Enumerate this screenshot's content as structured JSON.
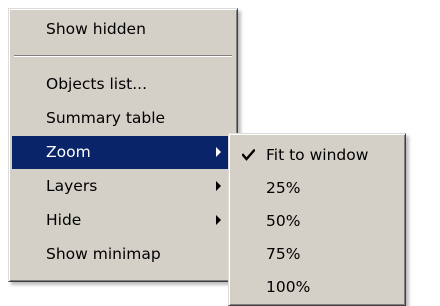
{
  "context_menu": {
    "items": [
      {
        "label": "Show hidden"
      },
      {
        "label": "Objects list..."
      },
      {
        "label": "Summary table"
      },
      {
        "label": "Zoom",
        "submenu": true,
        "highlighted": true
      },
      {
        "label": "Layers",
        "submenu": true
      },
      {
        "label": "Hide",
        "submenu": true
      },
      {
        "label": "Show minimap"
      }
    ]
  },
  "zoom_submenu": {
    "items": [
      {
        "label": "Fit to window",
        "checked": true,
        "icon": "checkmark-icon"
      },
      {
        "label": "25%"
      },
      {
        "label": "50%"
      },
      {
        "label": "75%"
      },
      {
        "label": "100%"
      }
    ]
  },
  "colors": {
    "menu_background": "#d4d0c8",
    "highlight": "#0a246a",
    "highlight_text": "#ffffff"
  }
}
